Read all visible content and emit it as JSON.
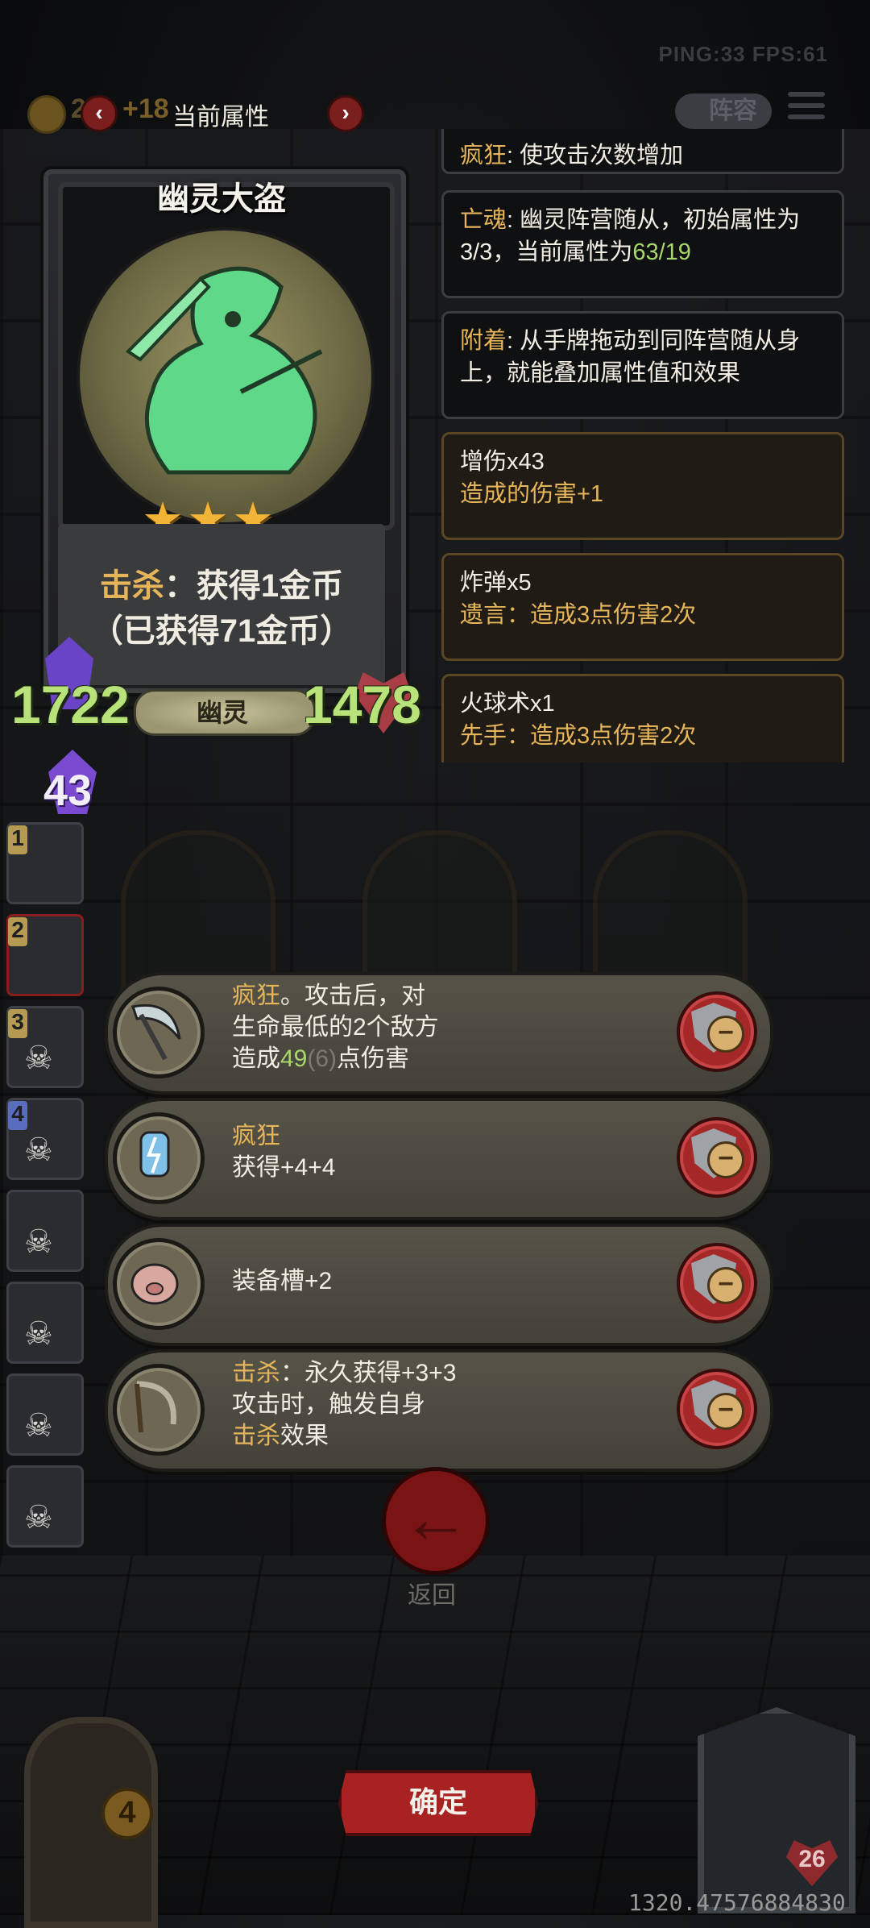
{
  "status": {
    "ping_fps": "PING:33   FPS:61"
  },
  "top_bar": {
    "gold_digit": "2",
    "gold_bonus": "+18",
    "title": "当前属性",
    "prev_symbol": "‹",
    "next_symbol": "›",
    "lineup_label": "阵容"
  },
  "card": {
    "name": "幽灵大盗",
    "stars": "★★★",
    "star_count": 3,
    "kill_keyword": "击杀",
    "kill_text": "：获得1金币",
    "earned_text": "（已获得71金币）",
    "attack": "1722",
    "health": "1478",
    "tribe": "幽灵",
    "level": "43"
  },
  "info_panel": [
    {
      "keyword": "疯狂",
      "text": ": 使攻击次数增加",
      "type": "keyword"
    },
    {
      "keyword": "亡魂",
      "text": ": 幽灵阵营随从，初始属性为3/3，当前属性为",
      "highlight": "63/19",
      "type": "keyword"
    },
    {
      "keyword": "附着",
      "text": ": 从手牌拖动到同阵营随从身上，就能叠加属性值和效果",
      "type": "keyword"
    },
    {
      "title": "增伤x43",
      "desc": "造成的伤害+1",
      "type": "equip"
    },
    {
      "title": "炸弹x5",
      "desc": "遗言：造成3点伤害2次",
      "type": "equip"
    },
    {
      "title": "火球术x1",
      "desc": "先手：造成3点伤害2次",
      "type": "equip"
    }
  ],
  "team_slots": [
    "1",
    "2",
    "3",
    "4"
  ],
  "effects": [
    {
      "keyword": "疯狂",
      "line1_rest": "。攻击后，对",
      "line2": "生命最低的2个敌方",
      "line3_pre": "造成",
      "line3_value": "49",
      "line3_faded": "(6)",
      "line3_post": "点伤害",
      "icon": "scythe-icon"
    },
    {
      "keyword": "疯狂",
      "line2": "获得+4+4",
      "icon": "lightning-amulet-icon"
    },
    {
      "line1": "装备槽+2",
      "icon": "pig-icon"
    },
    {
      "keyword": "击杀",
      "line1_rest": "：永久获得+3+3",
      "line2": "攻击时，触发自身",
      "line3_keyword": "击杀",
      "line3_post": "效果",
      "icon": "sickle-icon"
    }
  ],
  "remove_symbol": "−",
  "back_button": {
    "symbol": "←",
    "label": "返回"
  },
  "confirm_button": {
    "label": "确定"
  },
  "door_count": "4",
  "hero_hp": "26",
  "coordinate_readout": "1320.47576884830",
  "colors": {
    "keyword": "#e6b55a",
    "stat_green": "#b7e37a",
    "red_button": "#a82222"
  }
}
